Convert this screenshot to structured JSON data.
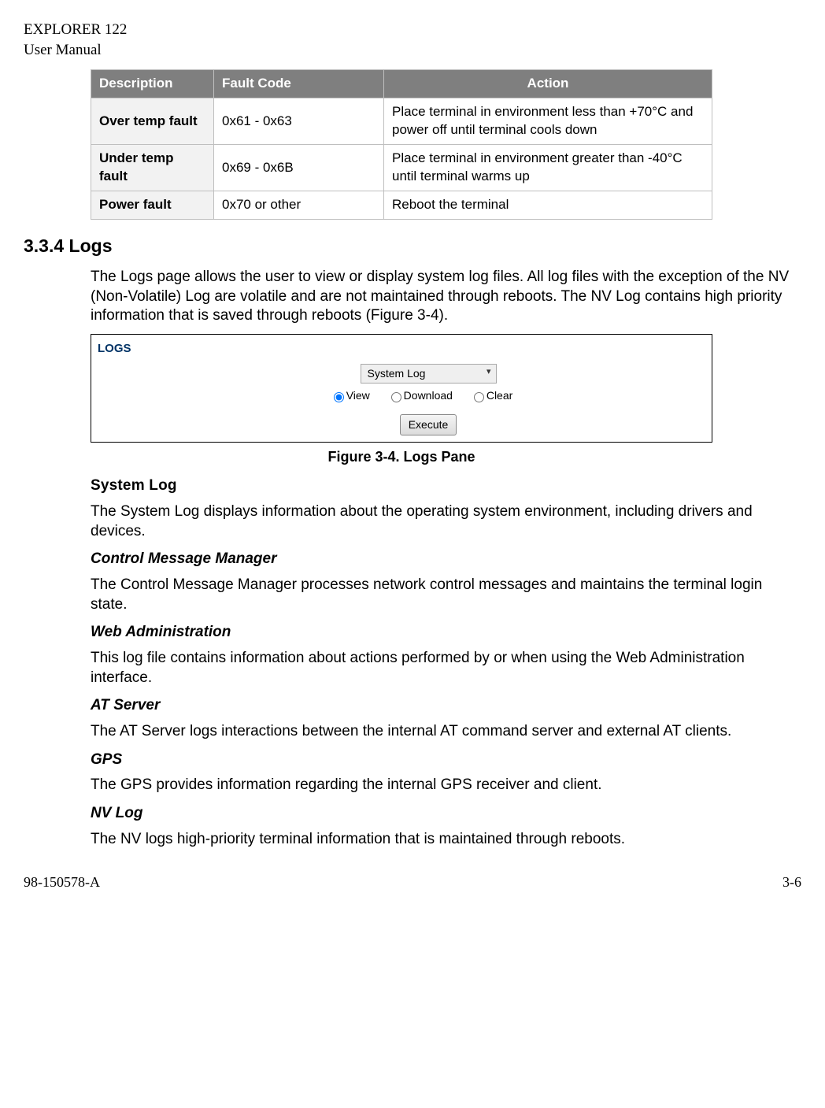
{
  "header": {
    "line1": "EXPLORER 122",
    "line2": "User Manual"
  },
  "table": {
    "headers": {
      "desc": "Description",
      "fault": "Fault Code",
      "action": "Action"
    },
    "rows": [
      {
        "desc": "Over temp fault",
        "fault": "0x61 - 0x63",
        "action": "Place terminal in environment less than +70°C and power off until terminal cools down"
      },
      {
        "desc": "Under temp fault",
        "fault": "0x69 - 0x6B",
        "action": "Place terminal in environment greater than -40°C until terminal warms up"
      },
      {
        "desc": "Power fault",
        "fault": "0x70 or other",
        "action": "Reboot the terminal"
      }
    ]
  },
  "section": {
    "heading": "3.3.4 Logs",
    "intro": "The Logs page allows the user to view or display system log files. All log files with the exception of the NV (Non-Volatile) Log are volatile and are not maintained through reboots. The NV Log contains high priority information that is saved through reboots (Figure 3-4)."
  },
  "figure": {
    "panel_title": "LOGS",
    "select_value": "System Log",
    "radios": {
      "view": "View",
      "download": "Download",
      "clear": "Clear"
    },
    "button": "Execute",
    "caption": "Figure 3-4. Logs Pane"
  },
  "subs": {
    "syslog_h": "System Log",
    "syslog_p": "The System Log displays information about the operating system environment, including drivers and devices.",
    "cmm_h": "Control Message Manager",
    "cmm_p": "The Control Message Manager processes network control messages and maintains the terminal login state.",
    "web_h": "Web Administration",
    "web_p": "This log file contains information about actions performed by or when using the Web Administration interface.",
    "at_h": "AT Server",
    "at_p": "The AT Server logs interactions between the internal AT command server and external AT clients.",
    "gps_h": "GPS",
    "gps_p": "The GPS provides information regarding the internal GPS receiver and client.",
    "nv_h": "NV Log",
    "nv_p": "The NV logs high-priority terminal information that is maintained through reboots."
  },
  "footer": {
    "left": "98-150578-A",
    "right": "3-6"
  }
}
